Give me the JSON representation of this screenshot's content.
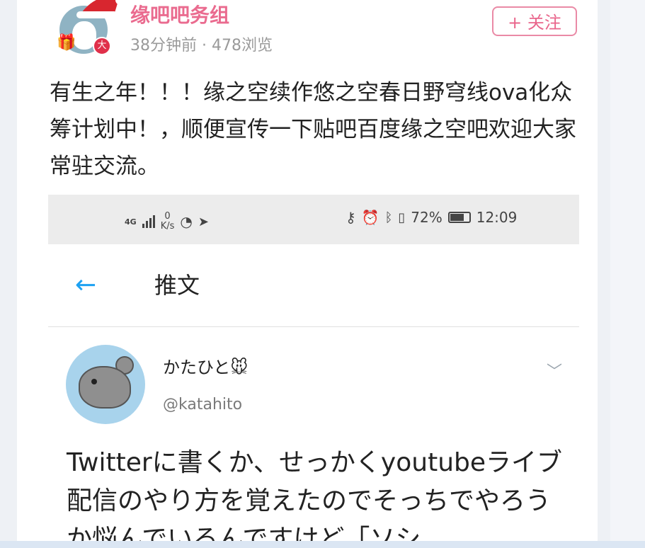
{
  "post": {
    "group_name": "缘吧吧务组",
    "meta": "38分钟前 · 478浏览",
    "follow_label": "+ 关注",
    "badge": "大",
    "text": "有生之年！！！缘之空续作悠之空春日野穹线ova化众筹计划中！，顺便宣传一下贴吧百度缘之空吧欢迎大家常驻交流。"
  },
  "embedded_screenshot": {
    "status_bar": {
      "network": "4G",
      "speed_value": "0",
      "speed_unit": "K/s",
      "battery_text": "72%",
      "battery_level": 0.72,
      "time": "12:09"
    },
    "twitter": {
      "header_title": "推文",
      "user_name": "かたひと🐭",
      "user_handle": "@katahito",
      "tweet_text": "Twitterに書くか、せっかくyoutubeライブ配信のやり方を覚えたのでそっちでやろうか悩んでいるんですけど「ソシ"
    }
  },
  "icons": [
    "santa-hat-icon",
    "gift-icon",
    "back-arrow-icon",
    "chevron-down-icon",
    "key-icon",
    "alarm-icon",
    "bluetooth-icon",
    "vibrate-icon",
    "battery-icon",
    "signal-icon",
    "location-icon"
  ],
  "colors": {
    "group_name": "#ea6b8f",
    "follow_border": "#ea8aa6",
    "twitter_blue": "#1da1f2",
    "status_bar_bg": "#ececec"
  }
}
